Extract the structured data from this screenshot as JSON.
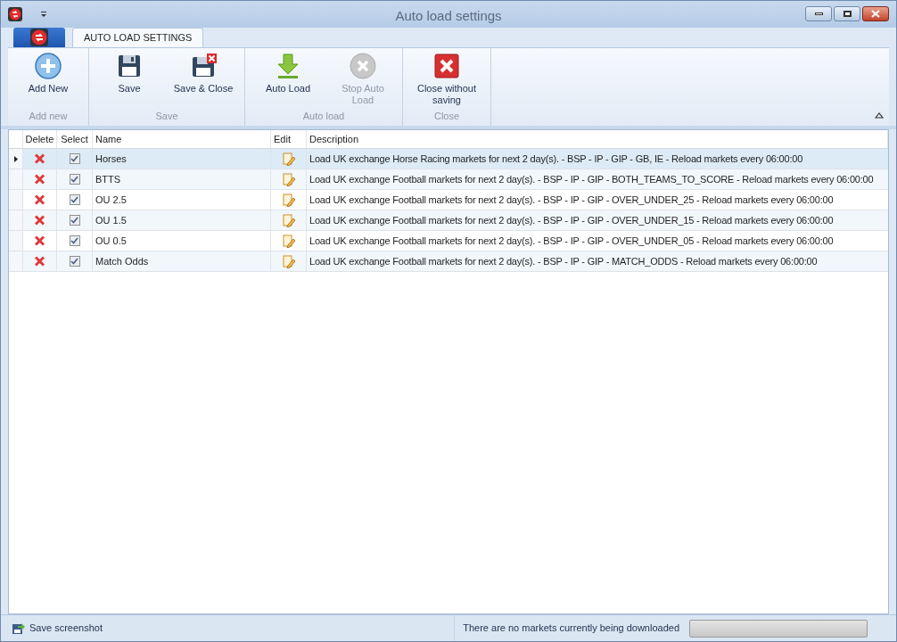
{
  "window": {
    "title": "Auto load settings"
  },
  "tabs": [
    {
      "label": "AUTO LOAD SETTINGS",
      "selected": true
    }
  ],
  "ribbon": {
    "groups": [
      {
        "label": "Add new",
        "buttons": [
          {
            "label": "Add New",
            "disabled": false
          }
        ]
      },
      {
        "label": "Save",
        "buttons": [
          {
            "label": "Save",
            "disabled": false
          },
          {
            "label": "Save & Close",
            "disabled": false
          }
        ]
      },
      {
        "label": "Auto load",
        "buttons": [
          {
            "label": "Auto Load",
            "disabled": false
          },
          {
            "label": "Stop Auto Load",
            "disabled": true
          }
        ]
      },
      {
        "label": "Close",
        "buttons": [
          {
            "label": "Close without saving",
            "disabled": false
          }
        ]
      }
    ]
  },
  "table": {
    "columns": [
      "Delete",
      "Select",
      "Name",
      "Edit",
      "Description"
    ],
    "rows": [
      {
        "name": "Horses",
        "checked": true,
        "selected": true,
        "description": "Load UK exchange Horse Racing markets for next 2 day(s). - BSP - IP - GIP - GB, IE - Reload markets every 06:00:00"
      },
      {
        "name": "BTTS",
        "checked": true,
        "selected": false,
        "description": "Load UK exchange Football markets for next 2 day(s). - BSP - IP - GIP - BOTH_TEAMS_TO_SCORE - Reload markets every 06:00:00"
      },
      {
        "name": "OU 2.5",
        "checked": true,
        "selected": false,
        "description": "Load UK exchange Football markets for next 2 day(s). - BSP - IP - GIP - OVER_UNDER_25 - Reload markets every 06:00:00"
      },
      {
        "name": "OU 1.5",
        "checked": true,
        "selected": false,
        "description": "Load UK exchange Football markets for next 2 day(s). - BSP - IP - GIP - OVER_UNDER_15 - Reload markets every 06:00:00"
      },
      {
        "name": "OU 0.5",
        "checked": true,
        "selected": false,
        "description": "Load UK exchange Football markets for next 2 day(s). - BSP - IP - GIP - OVER_UNDER_05 - Reload markets every 06:00:00"
      },
      {
        "name": "Match Odds",
        "checked": true,
        "selected": false,
        "description": "Load UK exchange Football markets for next 2 day(s). - BSP - IP - GIP - MATCH_ODDS - Reload markets every 06:00:00"
      }
    ]
  },
  "status_bar": {
    "screenshot_button": "Save screenshot",
    "message": "There are no markets currently being downloaded",
    "progress": {
      "level": 0
    }
  }
}
